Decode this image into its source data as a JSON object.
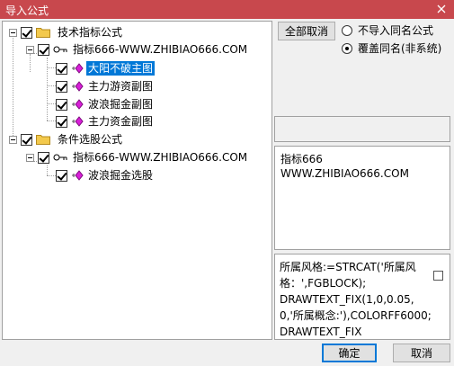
{
  "window": {
    "title": "导入公式"
  },
  "tree": {
    "groups": [
      {
        "label": "技术指标公式",
        "checked": true,
        "child": {
          "label": "指标666-WWW.ZHIBIAO666.COM",
          "checked": true,
          "items": [
            {
              "label": "大阳不破主图",
              "checked": true,
              "selected": true
            },
            {
              "label": "主力游资副图",
              "checked": true
            },
            {
              "label": "波浪掘金副图",
              "checked": true
            },
            {
              "label": "主力资金副图",
              "checked": true
            }
          ]
        }
      },
      {
        "label": "条件选股公式",
        "checked": true,
        "child": {
          "label": "指标666-WWW.ZHIBIAO666.COM",
          "checked": true,
          "items": [
            {
              "label": "波浪掘金选股",
              "checked": true
            }
          ]
        }
      }
    ]
  },
  "options": {
    "cancel_all_label": "全部取消",
    "radio_skip": "不导入同名公式",
    "radio_overwrite": "覆盖同名(非系统)",
    "selected": "overwrite"
  },
  "info": {
    "line1": "指标666",
    "line2": "WWW.ZHIBIAO666.COM"
  },
  "code": {
    "text": "所属风格:=STRCAT('所属风格：',FGBLOCK);\nDRAWTEXT_FIX(1,0,0.05,0,'所属概念:'),COLORFF6000;\nDRAWTEXT_FIX"
  },
  "footer": {
    "ok_label": "确定",
    "cancel_label": "取消"
  },
  "colors": {
    "titlebar": "#c8484d",
    "selection": "#0078d7",
    "folder": "#f3c94c",
    "gem": "#d81fd8"
  }
}
